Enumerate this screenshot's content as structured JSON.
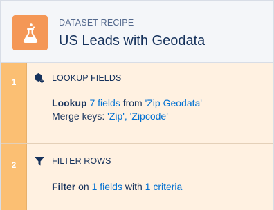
{
  "header": {
    "eyebrow": "DATASET RECIPE",
    "title": "US Leads with Geodata",
    "icon": "flask-icon",
    "icon_color": "#f49756"
  },
  "steps": [
    {
      "number": "1",
      "icon": "hexagon-plus-icon",
      "label": "LOOKUP FIELDS",
      "line1": {
        "verb": "Lookup",
        "fields_link": "7 fields",
        "from_text": "from",
        "source_link": "'Zip Geodata'"
      },
      "line2": {
        "prefix": "Merge keys:",
        "key1_link": "'Zip',",
        "key2_link": "'Zipcode'"
      }
    },
    {
      "number": "2",
      "icon": "funnel-icon",
      "label": "FILTER ROWS",
      "line1": {
        "verb": "Filter",
        "on_text": "on",
        "fields_link": "1 fields",
        "with_text": "with",
        "criteria_link": "1 criteria"
      }
    }
  ],
  "colors": {
    "accent_link": "#0070d2",
    "step_background": "#fff1e1",
    "step_rail": "#fbbf73",
    "header_background": "#f4f6f9",
    "text": "#16325c"
  }
}
